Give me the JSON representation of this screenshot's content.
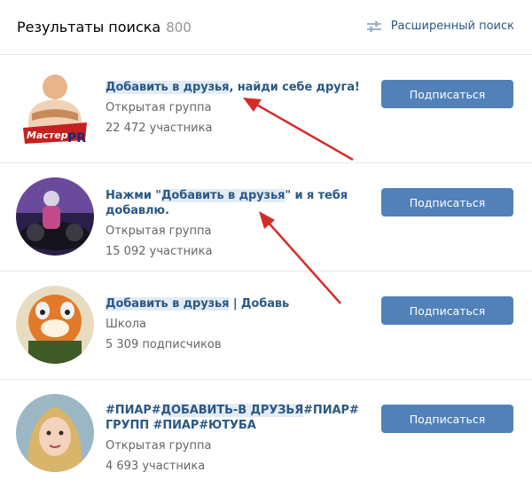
{
  "header": {
    "title": "Результаты поиска",
    "count": "800",
    "extended_search": "Расширенный поиск"
  },
  "results": [
    {
      "name_hl": "Добавить в друзья",
      "name_rest": ", найди себе друга!",
      "type": "Открытая группа",
      "members": "22 472 участника",
      "button": "Подписаться",
      "avatar_text": "Мастер PR"
    },
    {
      "name_pre": "Нажми \"",
      "name_hl": "Добавить в друзья",
      "name_rest": "\" и я тебя добавлю.",
      "type": "Открытая группа",
      "members": "15 092 участника",
      "button": "Подписаться"
    },
    {
      "name_hl": "Добавить в друзья",
      "name_rest": " | Добавь",
      "type": "Школа",
      "members": "5 309 подписчиков",
      "button": "Подписаться"
    },
    {
      "name_pre": "#ПИАР#",
      "name_hl": "ДОБАВИТЬ-В ДРУЗЬЯ",
      "name_rest": "#ПИАР# ГРУПП #ПИАР#ЮТУБА",
      "type": "Открытая группа",
      "members": "4 693 участника",
      "button": "Подписаться"
    }
  ],
  "colors": {
    "accent": "#5181b8",
    "link": "#2a5885",
    "arrow": "#d62b2b"
  },
  "icons": {
    "extended_search": "sliders-icon",
    "annotation": "red-arrow"
  }
}
